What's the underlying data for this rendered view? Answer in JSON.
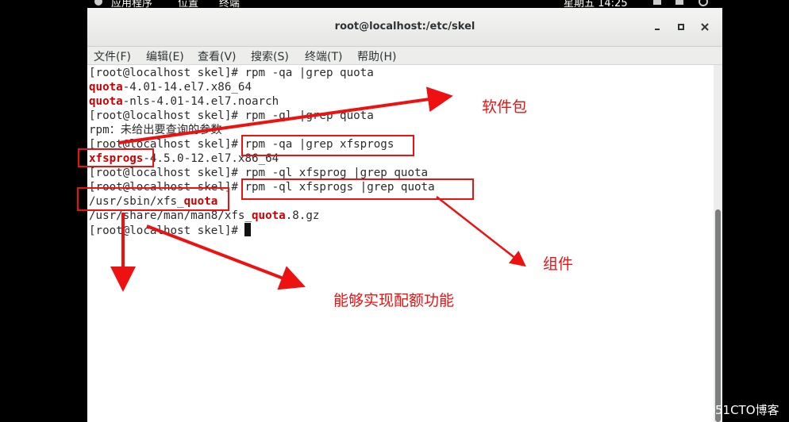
{
  "top_panel": {
    "apps": "应用程序",
    "places": "位置",
    "terminal": "终端",
    "clock": "星期五 14:25"
  },
  "window": {
    "title": "root@localhost:/etc/skel",
    "minimize": "▪",
    "close": "✕"
  },
  "menu": [
    "文件(F)",
    "编辑(E)",
    "查看(V)",
    "搜索(S)",
    "终端(T)",
    "帮助(H)"
  ],
  "terminal": {
    "l1": "[root@localhost skel]# rpm -qa |grep quota",
    "l2_hl": "quota",
    "l2_rest": "-4.01-14.el7.x86_64",
    "l3_hl": "quota",
    "l3_rest": "-nls-4.01-14.el7.noarch",
    "l4": "[root@localhost skel]# rpm -ql |grep quota",
    "l5": "rpm：未给出要查询的参数",
    "l6": "[root@localhost skel]# rpm -qa |grep xfsprogs",
    "l7_hl": "xfsprogs",
    "l7_rest": "-4.5.0-12.el7.x86_64",
    "l8": "[root@localhost skel]# rpm -ql xfsprog |grep quota",
    "l9": "[root@localhost skel]# rpm -ql xfsprogs |grep quota",
    "l10_pre": "/usr/sbin/xfs_",
    "l10_hl": "quota",
    "l11_pre": "/usr/share/man/man8/xfs_",
    "l11_hl": "quota",
    "l11_rest": ".8.gz",
    "l12": "[root@localhost skel]# "
  },
  "annotations": {
    "package": "软件包",
    "component": "组件",
    "quota_function": "能够实现配额功能"
  },
  "watermark": "@51CTO博客",
  "colors": {
    "annotation": "#ee1111",
    "highlight": "#cc0000"
  }
}
